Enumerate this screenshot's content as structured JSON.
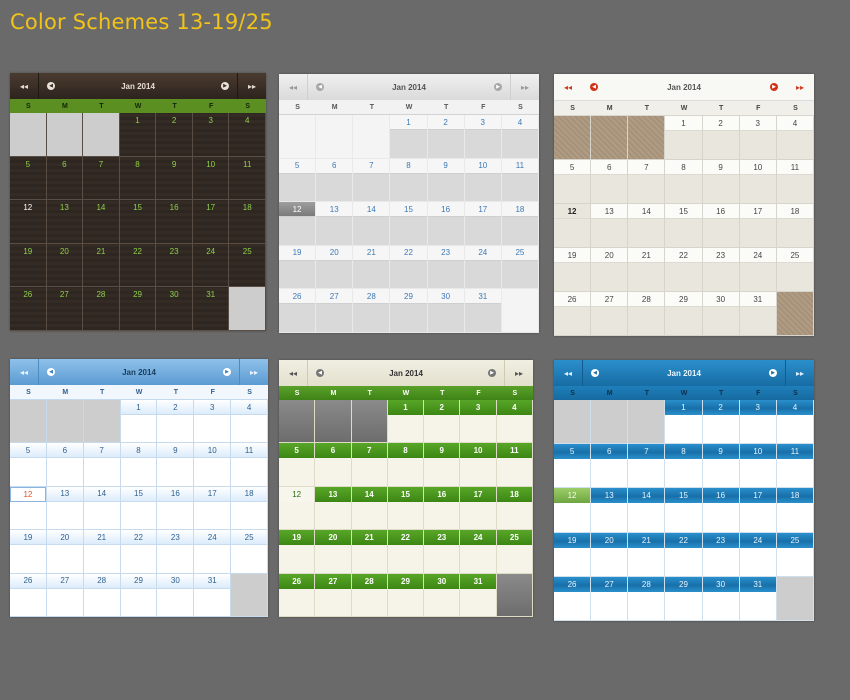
{
  "page_title": "Color Schemes 13-19/25",
  "calendar": {
    "month_label": "Jan  2014",
    "prev_year_glyph": "◂◂",
    "next_year_glyph": "▸▸",
    "prev_month_glyph": "◀",
    "next_month_glyph": "▶",
    "weekdays": [
      "S",
      "M",
      "T",
      "W",
      "T",
      "F",
      "S"
    ],
    "today": "12",
    "weeks": [
      [
        "",
        "",
        "",
        "1",
        "2",
        "3",
        "4"
      ],
      [
        "5",
        "6",
        "7",
        "8",
        "9",
        "10",
        "11"
      ],
      [
        "12",
        "13",
        "14",
        "15",
        "16",
        "17",
        "18"
      ],
      [
        "19",
        "20",
        "21",
        "22",
        "23",
        "24",
        "25"
      ],
      [
        "26",
        "27",
        "28",
        "29",
        "30",
        "31",
        ""
      ]
    ]
  },
  "schemes": [
    {
      "id": "dark-brown",
      "accent": "#332a23",
      "day_color": "#8fd14a",
      "dow_color": "#5c8f22"
    },
    {
      "id": "light-grey",
      "accent": "#e7e7e7",
      "day_color": "#3c78b6"
    },
    {
      "id": "linen",
      "accent": "#ecebe4",
      "nav_color": "#cf3217",
      "empty_color": "#a6927a"
    },
    {
      "id": "light-blue",
      "accent": "#5b9bd2",
      "today_color": "#e0522a"
    },
    {
      "id": "green-cream",
      "accent": "#3e8316",
      "background": "#f4f2e6"
    },
    {
      "id": "ocean-blue",
      "accent": "#176ca4",
      "today_color": "#6da640"
    }
  ]
}
